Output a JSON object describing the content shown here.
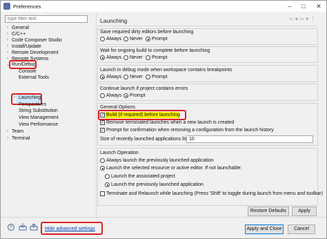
{
  "window": {
    "title": "Preferences"
  },
  "filter": {
    "placeholder": "type filter text"
  },
  "tree": {
    "items": [
      {
        "label": "General",
        "twisty": "›"
      },
      {
        "label": "C/C++",
        "twisty": "›"
      },
      {
        "label": "Code Composer Studio",
        "twisty": "›"
      },
      {
        "label": "Install/Update",
        "twisty": "›"
      },
      {
        "label": "Remote Development",
        "twisty": "›"
      },
      {
        "label": "Remote Systems",
        "twisty": "›"
      },
      {
        "label": "Run/Debug",
        "twisty": "⌄"
      },
      {
        "label": "Console"
      },
      {
        "label": "External Tools"
      },
      {
        "label": "Launching",
        "twisty": "›"
      },
      {
        "label": "Perspectives"
      },
      {
        "label": "String Substitution"
      },
      {
        "label": "View Management"
      },
      {
        "label": "View Performance"
      },
      {
        "label": "Team",
        "twisty": "›"
      },
      {
        "label": "Terminal",
        "twisty": "›"
      }
    ]
  },
  "page": {
    "title": "Launching",
    "nav_arrows": "⇦ ▾ ⇨ ▾ ⋮"
  },
  "groups": {
    "save_editors": {
      "label": "Save required dirty editors before launching",
      "options": [
        "Always",
        "Never",
        "Prompt"
      ],
      "selected": "Prompt"
    },
    "wait_build": {
      "label": "Wait for ongoing build to complete before launching",
      "options": [
        "Always",
        "Never",
        "Prompt"
      ],
      "selected": "Always"
    },
    "debug_mode": {
      "label": "Launch in debug mode when workspace contains breakpoints",
      "options": [
        "Always",
        "Never",
        "Prompt"
      ],
      "selected": "Always"
    },
    "continue_errors": {
      "label": "Continue launch if project contains errors",
      "options": [
        "Always",
        "Prompt"
      ],
      "selected": "Prompt"
    },
    "general_options": {
      "label": "General Options",
      "build_before": "Build (if required) before launching",
      "remove_terminated": "Remove terminated launches when a new launch is created",
      "prompt_confirm": "Prompt for confirmation when removing a configuration from the launch history",
      "history_size_label": "Size of recently launched applications list:",
      "history_size_value": "10"
    },
    "launch_operation": {
      "label": "Launch Operation",
      "always_previous": "Always launch the previously launched application",
      "launch_selected": "Launch the selected resource or active editor. If not launchable:",
      "launch_associated": "Launch the associated project",
      "launch_previous": "Launch the previously launched application",
      "terminate_relaunch": "Terminate and Relaunch while launching (Press 'Shift' to toggle during launch from menu and toolbar)"
    }
  },
  "buttons": {
    "restore_defaults": "Restore Defaults",
    "apply": "Apply",
    "apply_close": "Apply and Close",
    "cancel": "Cancel"
  },
  "footer": {
    "hide_advanced": "Hide advanced settings",
    "help": "?"
  },
  "colors": {
    "highlight_red": "#e02020",
    "highlight_yellow": "#f7f000",
    "link": "#0645ad",
    "selection": "#cce8ff"
  }
}
